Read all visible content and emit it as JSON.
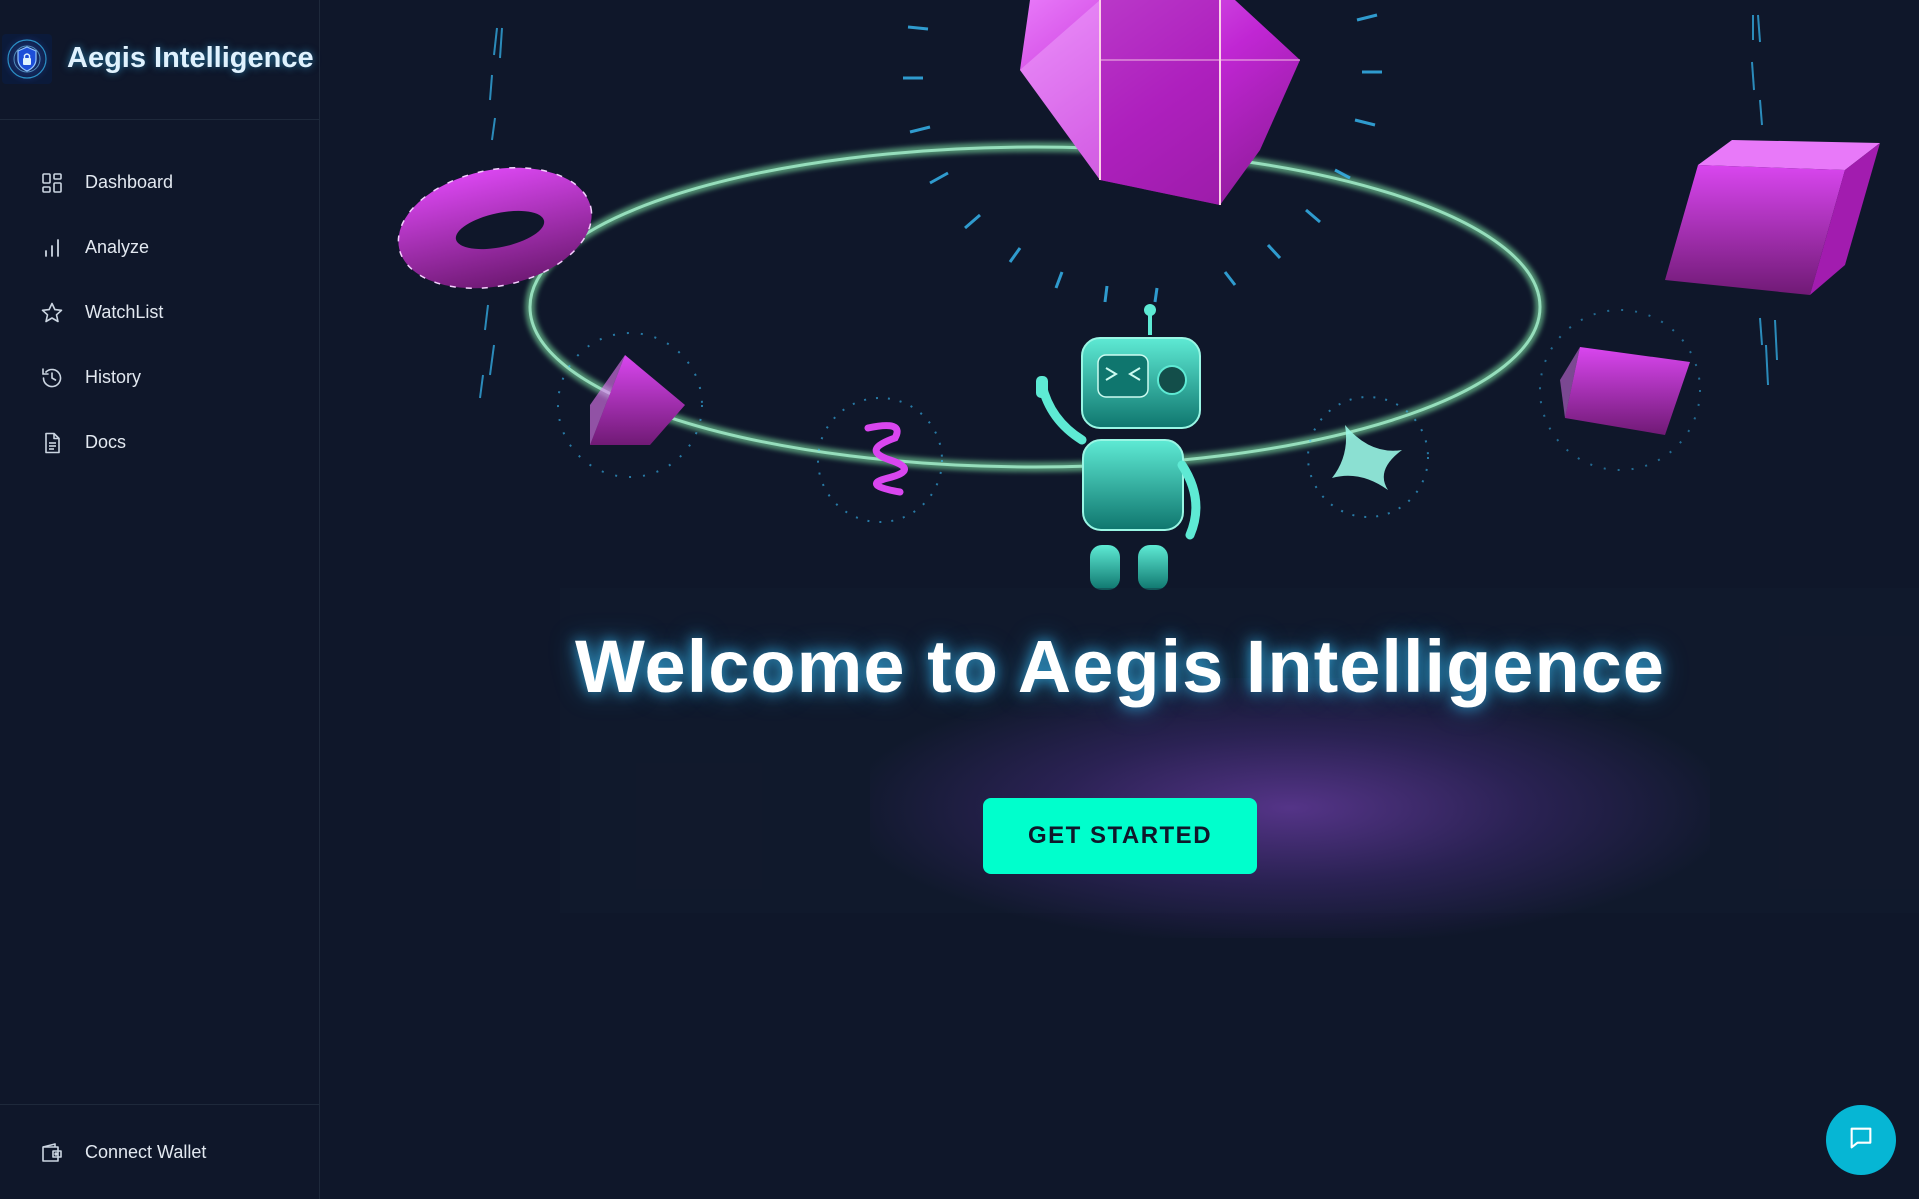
{
  "brand": {
    "title": "Aegis Intelligence",
    "logo_icon": "shield-lock-icon"
  },
  "nav": {
    "items": [
      {
        "label": "Dashboard",
        "icon": "dashboard-grid-icon"
      },
      {
        "label": "Analyze",
        "icon": "bar-chart-icon"
      },
      {
        "label": "WatchList",
        "icon": "star-icon"
      },
      {
        "label": "History",
        "icon": "history-clock-icon"
      },
      {
        "label": "Docs",
        "icon": "document-icon"
      }
    ]
  },
  "footer": {
    "wallet_label": "Connect Wallet",
    "wallet_icon": "wallet-icon"
  },
  "hero": {
    "title": "Welcome to Aegis Intelligence",
    "cta_label": "GET STARTED"
  },
  "chat": {
    "icon": "chat-bubble-icon"
  },
  "colors": {
    "background": "#0f172a",
    "accent": "#00ffcc",
    "chat": "#06b6d4",
    "magenta": "#c026d3",
    "teal": "#2dd4bf"
  }
}
